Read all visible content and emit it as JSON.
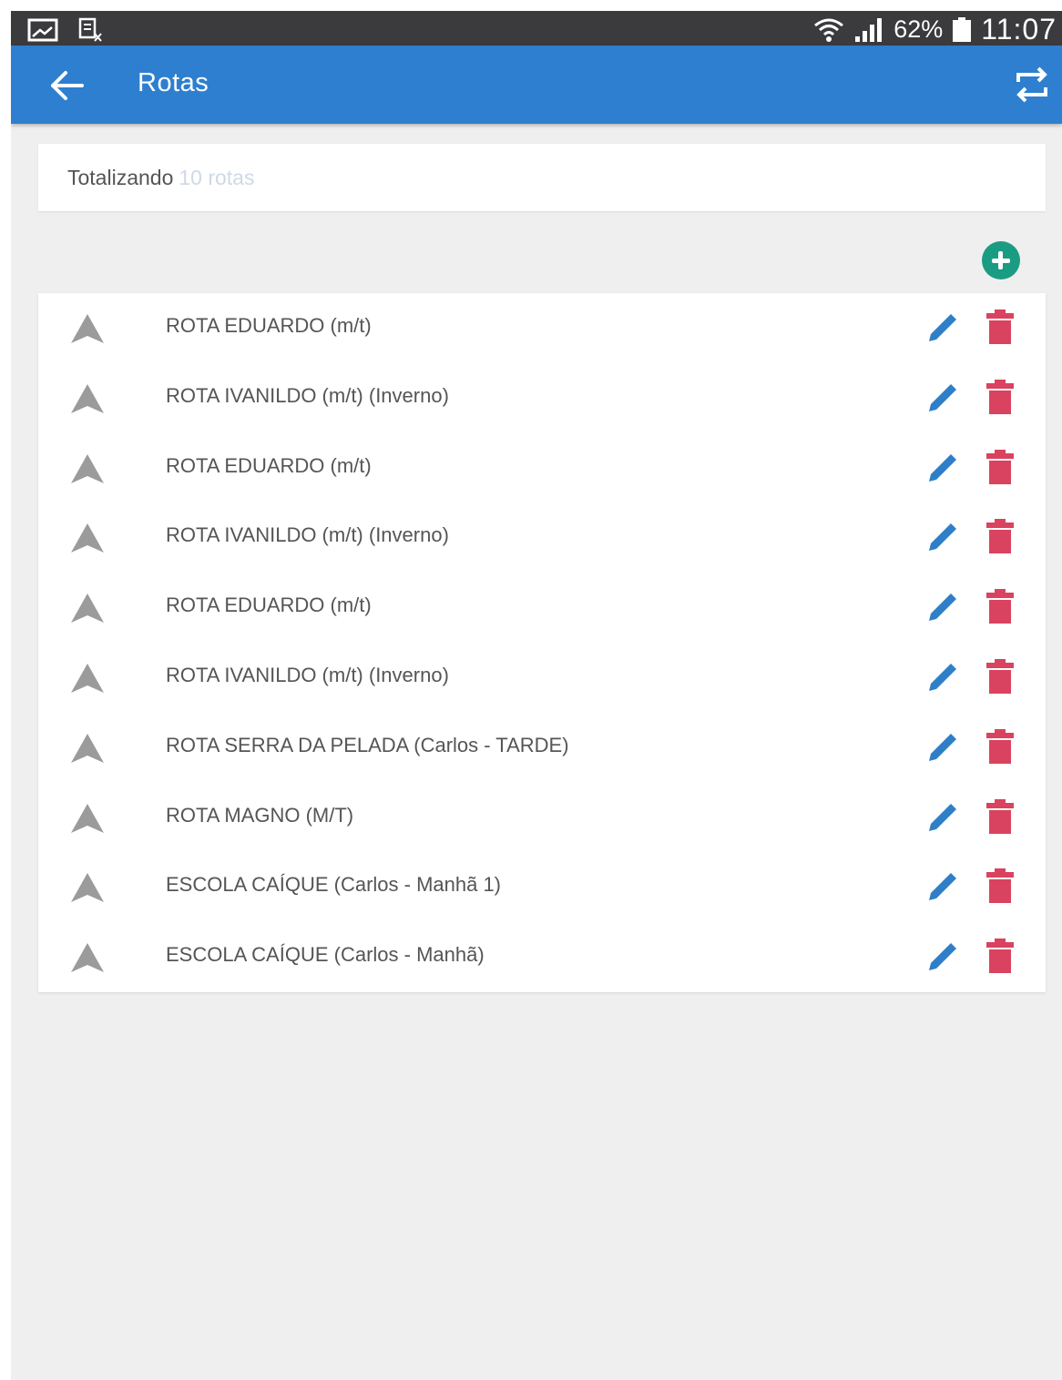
{
  "status_bar": {
    "battery": "62%",
    "time": "11:07",
    "icons": [
      "gallery-icon",
      "notification-icon",
      "wifi-icon",
      "signal-icon",
      "battery-icon"
    ]
  },
  "app_bar": {
    "title": "Rotas",
    "back_icon": "arrow-left-icon",
    "action_icon": "swap-icon",
    "color": "#2e7fcf"
  },
  "summary": {
    "label": "Totalizando",
    "count": "10 rotas"
  },
  "add_button": {
    "icon": "plus-circle-icon",
    "color": "#1a9c83"
  },
  "routes": [
    {
      "label": "ROTA EDUARDO (m/t)"
    },
    {
      "label": "ROTA IVANILDO (m/t) (Inverno)"
    },
    {
      "label": "ROTA EDUARDO (m/t)"
    },
    {
      "label": "ROTA IVANILDO (m/t) (Inverno)"
    },
    {
      "label": "ROTA EDUARDO (m/t)"
    },
    {
      "label": "ROTA IVANILDO (m/t) (Inverno)"
    },
    {
      "label": "ROTA SERRA DA PELADA (Carlos - TARDE)"
    },
    {
      "label": "ROTA MAGNO (M/T)"
    },
    {
      "label": "ESCOLA CAÍQUE (Carlos - Manhã 1)"
    },
    {
      "label": "ESCOLA CAÍQUE (Carlos - Manhã)"
    }
  ],
  "row_icons": {
    "leading": "navigation-arrow-icon",
    "edit": "pencil-icon",
    "delete": "trash-icon",
    "edit_color": "#2f7fc8",
    "delete_color": "#d9435f"
  }
}
